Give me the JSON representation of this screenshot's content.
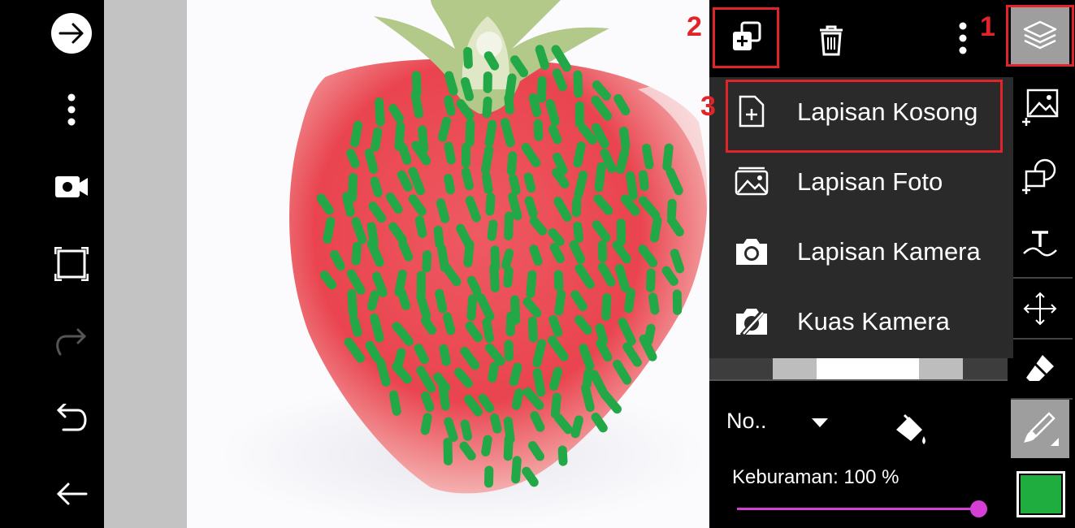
{
  "left_toolbar": {
    "items": [
      {
        "name": "forward-circle-icon"
      },
      {
        "name": "more-vert-icon"
      },
      {
        "name": "video-camera-icon"
      },
      {
        "name": "crop-frame-icon"
      },
      {
        "name": "redo-icon"
      },
      {
        "name": "undo-icon"
      },
      {
        "name": "back-arrow-icon"
      }
    ]
  },
  "layer_panel": {
    "top_buttons": [
      "add-layer-icon",
      "trash-icon",
      "more-vert-icon"
    ],
    "menu": [
      {
        "label": "Lapisan Kosong",
        "icon": "blank-file-plus-icon"
      },
      {
        "label": "Lapisan Foto",
        "icon": "photo-layer-icon"
      },
      {
        "label": "Lapisan Kamera",
        "icon": "camera-icon"
      },
      {
        "label": "Kuas Kamera",
        "icon": "camera-brush-icon"
      }
    ],
    "blend_mode": "No..",
    "opacity_label": "Keburaman: 100 %",
    "opacity_value": 1.0
  },
  "annotations": {
    "step1": "1",
    "step2": "2",
    "step3": "3"
  },
  "right_toolbar": {
    "items": [
      "layers-icon",
      "image-add-icon",
      "shape-add-icon",
      "text-icon",
      "move-icon",
      "eraser-icon",
      "brush-icon",
      "color-swatch"
    ]
  },
  "colors": {
    "highlight": "#e0242a",
    "accent_slider": "#d63fd6",
    "brush_color": "#1fad3f",
    "menu_bg": "#2a2a2a"
  }
}
